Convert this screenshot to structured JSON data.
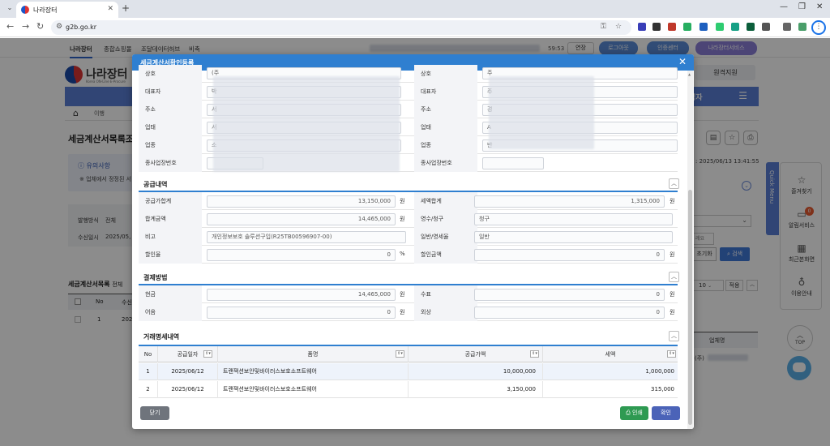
{
  "browser": {
    "tab_title": "나라장터",
    "url": "g2b.go.kr"
  },
  "site": {
    "util_links": [
      "나라장터",
      "종합쇼핑몰",
      "조달데이터허브",
      "비축"
    ],
    "session_timer": "59:53",
    "extend_label": "연장",
    "logout_label": "로그아웃",
    "cert_label": "인증센터",
    "services_label": "나라장터서비스",
    "logo_text": "나라장터",
    "logo_sub": "Korea ON-Line E-Procure",
    "remote_label": "원격지원",
    "gnb_items": [
      "발주",
      "영자"
    ],
    "breadcrumb": "이행",
    "page_title": "세금계산서목록조",
    "notice_title": "유의사항",
    "notice_text": "※ 업체에서 정정된 서",
    "search_labels": [
      "발행방식",
      "수신일시"
    ],
    "search_values": [
      "전체",
      "2025/05,"
    ],
    "list_title": "세금계산서목록",
    "list_total": "전체",
    "list_headers": [
      "No",
      "수신"
    ],
    "list_row": [
      "1",
      "2025"
    ],
    "date_text": ": 2025/06/13 13:41:55",
    "reset_label": "초기화",
    "search_label": "검색",
    "pagesize": "10",
    "apply_label": "적용",
    "right_head": "업체명",
    "right_row": "(주)",
    "right_input": "레요",
    "quick_menu": "Quick Menu",
    "side_items": [
      {
        "label": "즐겨찾기",
        "icon": "star-icon"
      },
      {
        "label": "알림서비스",
        "icon": "folder-icon",
        "badge": "0"
      },
      {
        "label": "최근본화면",
        "icon": "chart-icon"
      },
      {
        "label": "이용안내",
        "icon": "mic-icon"
      }
    ],
    "top_label": "TOP"
  },
  "modal": {
    "title": "세금계산서확인등록",
    "party_rows": [
      {
        "left_label": "상호",
        "left_value": "(주",
        "right_label": "상호",
        "right_value": "주"
      },
      {
        "left_label": "대표자",
        "left_value": "박",
        "right_label": "대표자",
        "right_value": "주"
      },
      {
        "left_label": "주소",
        "left_value": "서",
        "right_label": "주소",
        "right_value": "경"
      },
      {
        "left_label": "업태",
        "left_value": "서",
        "right_label": "업태",
        "right_value": "A"
      },
      {
        "left_label": "업종",
        "left_value": "소",
        "right_label": "업종",
        "right_value": "반"
      },
      {
        "left_label": "종사업장번호",
        "left_value": "",
        "right_label": "종사업장번호",
        "right_value": ""
      }
    ],
    "supply": {
      "section_title": "공급내역",
      "supply_amount_label": "공급가합계",
      "supply_amount": "13,150,000",
      "tax_total_label": "세액합계",
      "tax_total": "1,315,000",
      "total_label": "합계금액",
      "total": "14,465,000",
      "receipt_label": "영수/청구",
      "receipt_value": "청구",
      "remark_label": "비고",
      "remark_value": "개인정보보호 솔루션구입(R25TB00596907-00)",
      "general_label": "일반/영세율",
      "general_value": "일반",
      "discount_rate_label": "할인율",
      "discount_rate": "0",
      "discount_amount_label": "할인금액",
      "discount_amount": "0",
      "unit_won": "원",
      "unit_pct": "%"
    },
    "payment": {
      "section_title": "결제방법",
      "cash_label": "현금",
      "cash": "14,465,000",
      "check_label": "수표",
      "check": "0",
      "note_label": "어음",
      "note": "0",
      "credit_label": "외상",
      "credit": "0"
    },
    "details": {
      "section_title": "거래명세내역",
      "headers": [
        "No",
        "공급일자",
        "품명",
        "공급가액",
        "세액"
      ],
      "rows": [
        [
          "1",
          "2025/06/12",
          "트랜잭션보안및바이러스보호소프트웨어",
          "10,000,000",
          "1,000,000"
        ],
        [
          "2",
          "2025/06/12",
          "트랜잭션보안및바이러스보호소프트웨어",
          "3,150,000",
          "315,000"
        ]
      ]
    },
    "close_label": "닫기",
    "print_label": "인쇄",
    "confirm_label": "확인"
  },
  "colors": {
    "header_blue": "#2f7fd0",
    "gnb_blue": "#5a7fd6",
    "print_green": "#2e9a52",
    "confirm_blue": "#4b63b8",
    "close_gray": "#6f747c"
  }
}
